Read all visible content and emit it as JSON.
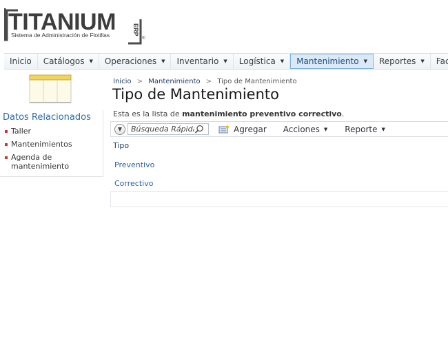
{
  "logo": {
    "brand": "TITANIUM",
    "badge": "ERP",
    "tagline": "Sistema de Administración de Flotillas",
    "registered": "®"
  },
  "nav": {
    "items": [
      {
        "label": "Inicio",
        "dropdown": false
      },
      {
        "label": "Catálogos",
        "dropdown": true
      },
      {
        "label": "Operaciones",
        "dropdown": true
      },
      {
        "label": "Inventario",
        "dropdown": true
      },
      {
        "label": "Logística",
        "dropdown": true
      },
      {
        "label": "Mantenimiento",
        "dropdown": true,
        "active": true
      },
      {
        "label": "Reportes",
        "dropdown": true
      },
      {
        "label": "Facturación",
        "dropdown": false
      }
    ]
  },
  "related": {
    "title": "Datos Relacionados",
    "items": [
      "Taller",
      "Mantenimientos",
      "Agenda de mantenimiento"
    ]
  },
  "breadcrumb": {
    "home": "Inicio",
    "section": "Mantenimiento",
    "current": "Tipo de Mantenimiento",
    "separator": ">"
  },
  "page": {
    "title": "Tipo de Mantenimiento",
    "description_prefix": "Esta es la lista de ",
    "description_bold": "mantenimiento preventivo correctivo",
    "description_suffix": "."
  },
  "toolbar": {
    "search_placeholder": "Búsqueda Rápida",
    "add_label": "Agregar",
    "actions_label": "Acciones",
    "report_label": "Reporte"
  },
  "table": {
    "column": "Tipo",
    "rows": [
      "Preventivo",
      "Correctivo"
    ]
  },
  "colors": {
    "accent": "#2b6aa8",
    "link": "#2d64a8",
    "bullet": "#c0392b",
    "active_tab_bg": "#dbe9f7"
  }
}
